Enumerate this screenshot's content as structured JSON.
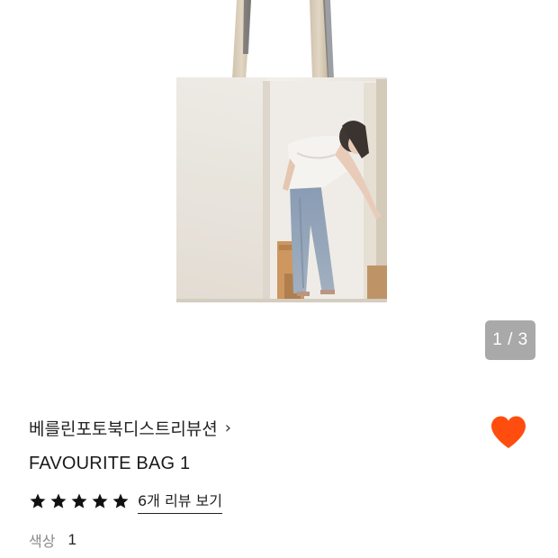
{
  "gallery": {
    "counter_text": "1 / 3"
  },
  "product": {
    "brand": "베를린포토북디스트리뷰션",
    "brand_chevron": "›",
    "title": "FAVOURITE BAG 1",
    "rating_stars": 5,
    "review_link": "6개 리뷰 보기",
    "option_label": "색상",
    "option_value": "1"
  },
  "colors": {
    "wishlist_heart": "#ff4d0f",
    "counter_bg": "#a9a9a9",
    "star": "#111111"
  },
  "icons": {
    "wishlist": "heart-icon",
    "rating": "star-icon",
    "brand_chevron": "chevron-right-icon"
  }
}
